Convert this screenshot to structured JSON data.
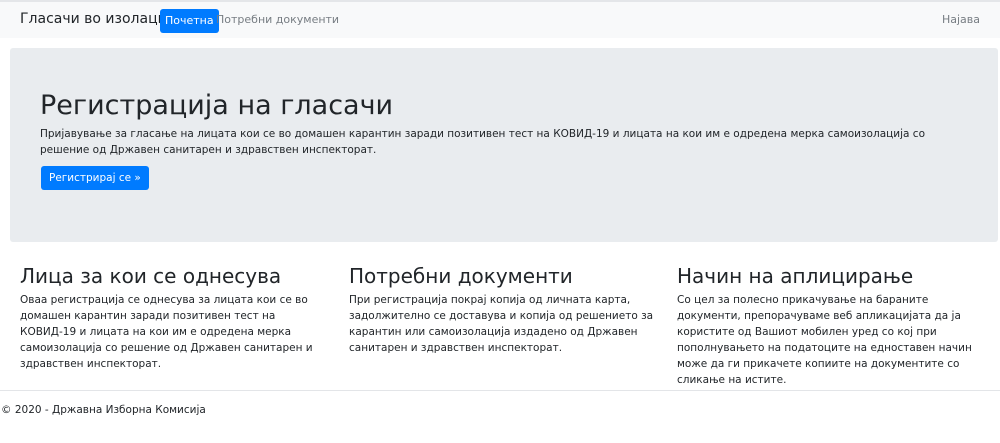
{
  "navbar": {
    "brand": "Гласачи во изолација",
    "items": [
      {
        "label": "Почетна",
        "active": true
      },
      {
        "label": "Потребни документи",
        "active": false
      }
    ],
    "login_label": "Најава"
  },
  "jumbotron": {
    "title": "Регистрација на гласачи",
    "text": "Пријавување за гласање на лицата кои се во домашен карантин заради позитивен тест на КОВИД-19 и лицата на кои им е одредена мерка самоизолација со решение од Државен санитарен и здравствен инспекторат.",
    "button_label": "Регистрирај се »"
  },
  "columns": [
    {
      "title": "Лица за кои се однесува",
      "text": "Оваа регистрација се однесува за лицата кои се во домашен карантин заради позитивен тест на КОВИД-19 и лицата на кои им е одредена мерка самоизолација со решение од Државен санитарен и здравствен инспекторат."
    },
    {
      "title": "Потребни документи",
      "text": "При регистрација покрај копија од личната карта, задолжително се доставува и копија од решението за карантин или самоизолација издадено од Државен санитарен и здравствен инспекторат."
    },
    {
      "title": "Начин на аплицирање",
      "text": "Со цел за полесно прикачување на бараните документи, препорачуваме веб апликацијата да ја користите од Вашиот мобилен уред со кој при пополнувањето на податоците на едноставен начин може да ги прикачете копиите на документите со сликање на истите."
    }
  ],
  "footer": {
    "text": "© 2020 - Државна Изборна Комисија"
  },
  "colors": {
    "primary": "#007bff",
    "navbar_bg": "#f8f9fa",
    "jumbotron_bg": "#e9ecef",
    "muted_link": "#777d83"
  }
}
